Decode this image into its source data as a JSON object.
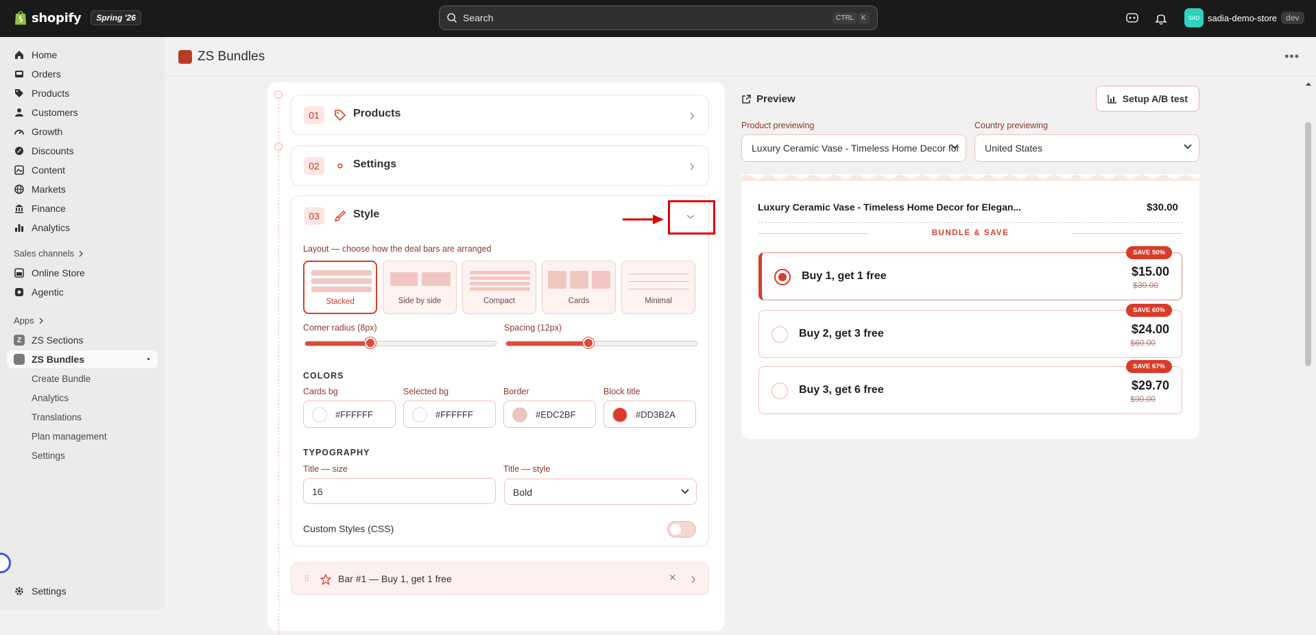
{
  "topbar": {
    "brand": "shopify",
    "edition": "Spring '26",
    "search_placeholder": "Search",
    "shortcut_ctrl": "CTRL",
    "shortcut_key": "K",
    "store_initials": "SAD",
    "store_name": "sadia-demo-store",
    "store_badge": "dev"
  },
  "sidebar": {
    "items": [
      {
        "label": "Home",
        "icon": "home-icon"
      },
      {
        "label": "Orders",
        "icon": "inbox-icon"
      },
      {
        "label": "Products",
        "icon": "tag-icon"
      },
      {
        "label": "Customers",
        "icon": "person-icon"
      },
      {
        "label": "Growth",
        "icon": "gauge-icon"
      },
      {
        "label": "Discounts",
        "icon": "discount-icon"
      },
      {
        "label": "Content",
        "icon": "content-icon"
      },
      {
        "label": "Markets",
        "icon": "globe-icon"
      },
      {
        "label": "Finance",
        "icon": "bank-icon"
      },
      {
        "label": "Analytics",
        "icon": "chart-icon"
      }
    ],
    "sales_channels_label": "Sales channels",
    "channels": [
      {
        "label": "Online Store",
        "icon": "store-icon"
      },
      {
        "label": "Agentic",
        "icon": "agentic-icon"
      }
    ],
    "apps_label": "Apps",
    "apps": [
      {
        "label": "ZS Sections"
      },
      {
        "label": "ZS Bundles"
      }
    ],
    "app_subitems": [
      "Create Bundle",
      "Analytics",
      "Translations",
      "Plan management",
      "Settings"
    ],
    "settings_label": "Settings"
  },
  "page": {
    "title": "ZS Bundles"
  },
  "editor": {
    "cards": [
      {
        "num": "01",
        "title": "Products"
      },
      {
        "num": "02",
        "title": "Settings"
      },
      {
        "num": "03",
        "title": "Style"
      }
    ],
    "layout_label": "Layout — choose how the deal bars are arranged",
    "layouts": [
      "Stacked",
      "Side by side",
      "Compact",
      "Cards",
      "Minimal"
    ],
    "corner_radius_label": "Corner radius (8px)",
    "corner_radius_value": 0.34,
    "spacing_label": "Spacing (12px)",
    "spacing_value": 0.43,
    "colors_heading": "COLORS",
    "colors": [
      {
        "label": "Cards bg",
        "hex": "#FFFFFF",
        "swatch": "#FFFFFF"
      },
      {
        "label": "Selected bg",
        "hex": "#FFFFFF",
        "swatch": "#FFFFFF"
      },
      {
        "label": "Border",
        "hex": "#EDC2BF",
        "swatch": "#EDC2BF"
      },
      {
        "label": "Block title",
        "hex": "#DD3B2A",
        "swatch": "#DD3B2A"
      }
    ],
    "typography_heading": "TYPOGRAPHY",
    "title_size_label": "Title — size",
    "title_size_value": "16",
    "title_style_label": "Title — style",
    "title_style_value": "Bold",
    "custom_css_label": "Custom Styles (CSS)",
    "bar1_title": "Bar #1 — Buy 1, get 1 free"
  },
  "preview": {
    "heading": "Preview",
    "ab_button": "Setup A/B test",
    "product_label": "Product previewing",
    "product_value": "Luxury Ceramic Vase - Timeless Home Decor for",
    "country_label": "Country previewing",
    "country_value": "United States",
    "product_name": "Luxury Ceramic Vase - Timeless Home Decor for Elegan...",
    "product_price": "$30.00",
    "bundle_heading": "BUNDLE & SAVE",
    "deals": [
      {
        "title": "Buy 1, get 1 free",
        "price": "$15.00",
        "original": "$30.00",
        "badge": "SAVE 50%",
        "selected": true
      },
      {
        "title": "Buy 2, get 3 free",
        "price": "$24.00",
        "original": "$60.00",
        "badge": "SAVE 60%",
        "selected": false
      },
      {
        "title": "Buy 3, get 6 free",
        "price": "$29.70",
        "original": "$90.00",
        "badge": "SAVE 67%",
        "selected": false
      }
    ]
  },
  "colors": {
    "accent": "#D93B2A",
    "topbar": "#1A1A1A"
  }
}
